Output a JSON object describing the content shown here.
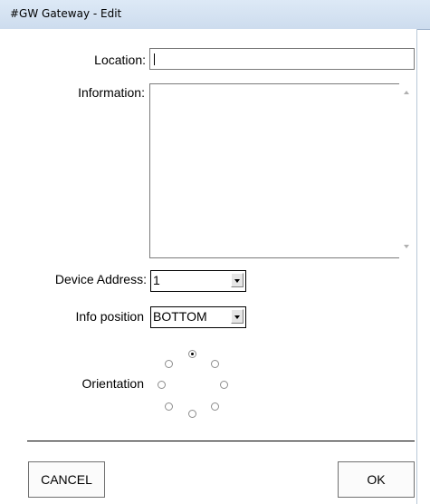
{
  "window": {
    "title": "#GW Gateway - Edit"
  },
  "form": {
    "location_label": "Location:",
    "location_value": "",
    "information_label": "Information:",
    "information_value": "",
    "device_address_label": "Device Address:",
    "device_address_value": "1",
    "info_position_label": "Info position",
    "info_position_value": "BOTTOM",
    "orientation_label": "Orientation",
    "orientation_selected": "up"
  },
  "buttons": {
    "cancel_label": "CANCEL",
    "ok_label": "OK"
  },
  "icons": {
    "dropdown": "chevron-down-icon",
    "scroll_up": "scroll-up-icon",
    "scroll_down": "scroll-down-icon"
  }
}
